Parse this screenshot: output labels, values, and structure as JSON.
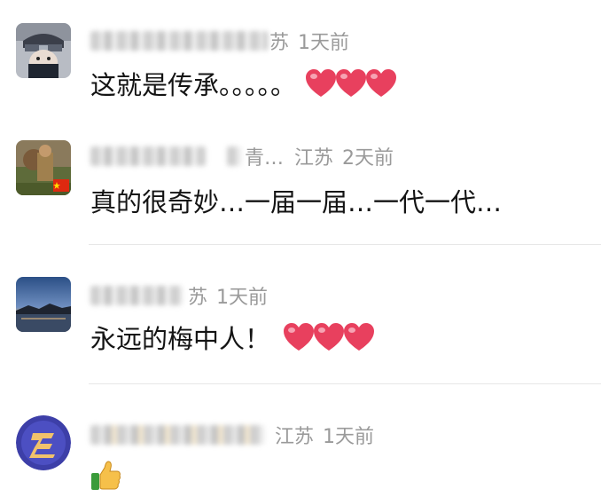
{
  "comments": [
    {
      "region": "苏",
      "time": "1天前",
      "text": "这就是传承。。。。。",
      "reactions": [
        "heart-emoji",
        "heart-emoji",
        "heart-emoji"
      ]
    },
    {
      "region": "江苏",
      "time": "2天前",
      "name_suffix": "青…",
      "text": "真的很奇妙…一届一届…一代一代…",
      "badge": "china-flag-icon"
    },
    {
      "region": "苏",
      "time": "1天前",
      "text": "永远的梅中人！",
      "reactions": [
        "heart-emoji",
        "heart-emoji",
        "heart-emoji"
      ]
    },
    {
      "region": "江苏",
      "time": "1天前",
      "text": "",
      "reactions": [
        "thumbs-up-emoji"
      ]
    }
  ],
  "colors": {
    "meta_text": "#9a9a9a",
    "content_text": "#141414",
    "heart": "#e8405e",
    "divider": "#e7e7e7"
  }
}
